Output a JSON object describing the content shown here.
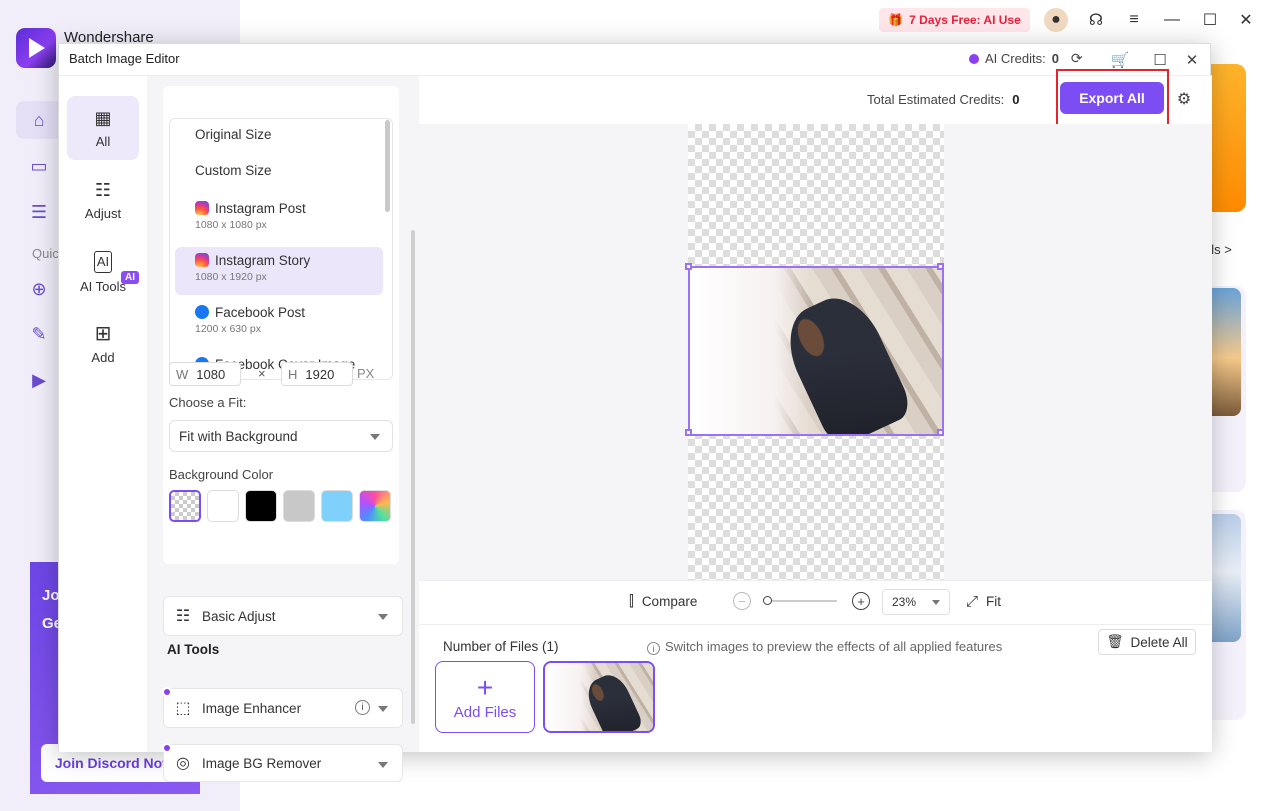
{
  "background_app": {
    "brand": "Wondershare",
    "quick_label": "Quic",
    "promo_text_line1": "Jo",
    "promo_text_line2": "Ge",
    "discord_button": "Join Discord Now",
    "trial_badge": "7 Days Free: AI Use",
    "tools_link": "ols >"
  },
  "dialog": {
    "title": "Batch Image Editor",
    "ai_credits_label": "AI Credits:",
    "ai_credits_value": "0"
  },
  "rail": {
    "items": [
      {
        "label": "All",
        "icon": "grid-icon"
      },
      {
        "label": "Adjust",
        "icon": "sliders-icon"
      },
      {
        "label": "AI Tools",
        "icon": "ai-icon"
      },
      {
        "label": "Add",
        "icon": "plus-square-icon"
      }
    ],
    "ai_badge": "AI"
  },
  "size_panel": {
    "presets": [
      {
        "label": "Original Size",
        "sub": "",
        "icon": ""
      },
      {
        "label": "Custom Size",
        "sub": "",
        "icon": ""
      },
      {
        "label": "Instagram Post",
        "sub": "1080 x 1080 px",
        "icon": "instagram-icon"
      },
      {
        "label": "Instagram Story",
        "sub": "1080 x 1920 px",
        "icon": "instagram-icon",
        "selected": true
      },
      {
        "label": "Facebook Post",
        "sub": "1200 x 630 px",
        "icon": "facebook-icon"
      },
      {
        "label": "Facebook Cover Image",
        "sub": "",
        "icon": "facebook-icon"
      }
    ],
    "width_label": "W",
    "width_value": "1080",
    "times": "×",
    "height_label": "H",
    "height_value": "1920",
    "unit": "PX",
    "fit_label": "Choose a Fit:",
    "fit_value": "Fit with Background",
    "bg_color_label": "Background Color",
    "swatches": [
      "transparent",
      "#ffffff",
      "#000000",
      "#c8c8c8",
      "#7fd0fb",
      "gradient"
    ]
  },
  "accordions": {
    "basic_adjust": "Basic Adjust",
    "ai_tools_heading": "AI Tools",
    "image_enhancer": "Image Enhancer",
    "image_bg_remover": "Image BG Remover"
  },
  "preview": {
    "credits_label": "Total Estimated Credits:",
    "credits_value": "0",
    "export_button": "Export All"
  },
  "zoombar": {
    "compare": "Compare",
    "zoom_value": "23%",
    "fit": "Fit"
  },
  "files": {
    "count_label": "Number of Files (1)",
    "hint": "Switch images to preview the effects of all applied features",
    "delete_all": "Delete All",
    "add_files": "Add Files"
  },
  "colors": {
    "accent": "#7b4df2",
    "highlight_frame": "#e3242b",
    "trial_text": "#e5223c"
  }
}
